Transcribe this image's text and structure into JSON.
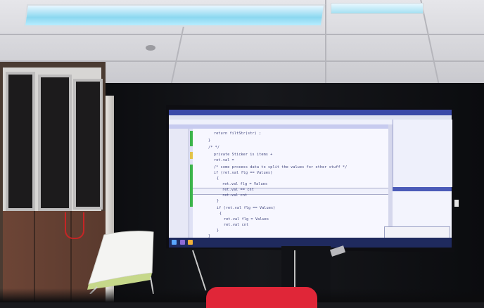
{
  "scene": {
    "description_none": "",
    "display": {
      "code_lines": [
        "return filtStr(str) ;",
        "}",
        "/* */",
        "private Sticker is items +",
        "ret.val =",
        "/* some process data to split the values for other stuff */",
        "if (ret.val flg == Values)",
        "{",
        "ret.val flg = Values",
        "ret.val == cnt",
        "ret.val cnt",
        "}",
        "if (ret.val flg == Values)",
        "{",
        "ret.val flg = Values",
        "ret.val cnt",
        "}",
        "}"
      ]
    }
  },
  "colors": {
    "screen_bg": "#dfe1f5",
    "titlebar": "#3b4aa8",
    "gutter_mark": "#3cb44b",
    "red_chair": "#e02638"
  },
  "icons": [
    "windows-start-icon",
    "taskbar-app-icon"
  ]
}
